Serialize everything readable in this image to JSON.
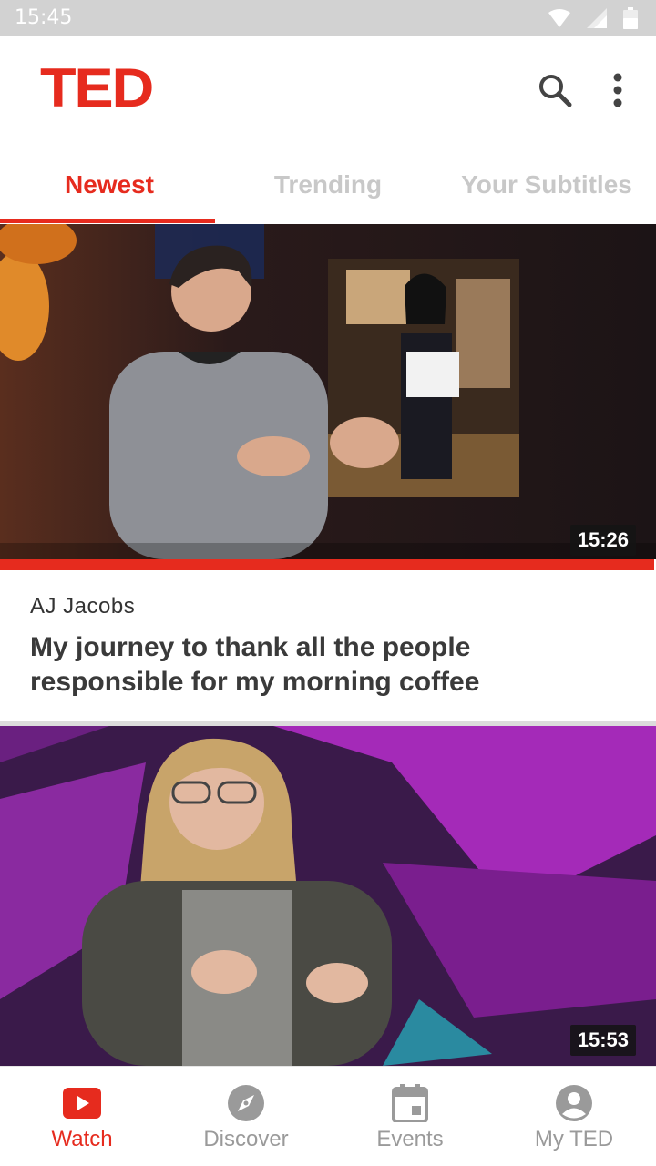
{
  "status_bar": {
    "time": "15:45"
  },
  "app_bar": {
    "logo": "TED",
    "search_icon": "search-icon",
    "menu_icon": "more-vert-icon"
  },
  "tabs": [
    {
      "label": "Newest",
      "active": true
    },
    {
      "label": "Trending",
      "active": false
    },
    {
      "label": "Your Subtitles",
      "active": false
    }
  ],
  "talks": [
    {
      "speaker": "AJ Jacobs",
      "title": "My journey to thank all the people responsible for my morning coffee",
      "duration": "15:26",
      "progress": 1.0
    },
    {
      "speaker": "",
      "title": "",
      "duration": "15:53"
    }
  ],
  "bottom_nav": [
    {
      "label": "Watch",
      "icon": "play-video-icon",
      "active": true
    },
    {
      "label": "Discover",
      "icon": "compass-icon",
      "active": false
    },
    {
      "label": "Events",
      "icon": "calendar-icon",
      "active": false
    },
    {
      "label": "My TED",
      "icon": "account-icon",
      "active": false
    }
  ],
  "colors": {
    "accent": "#e62b1e",
    "inactive": "#9a9a9a"
  }
}
